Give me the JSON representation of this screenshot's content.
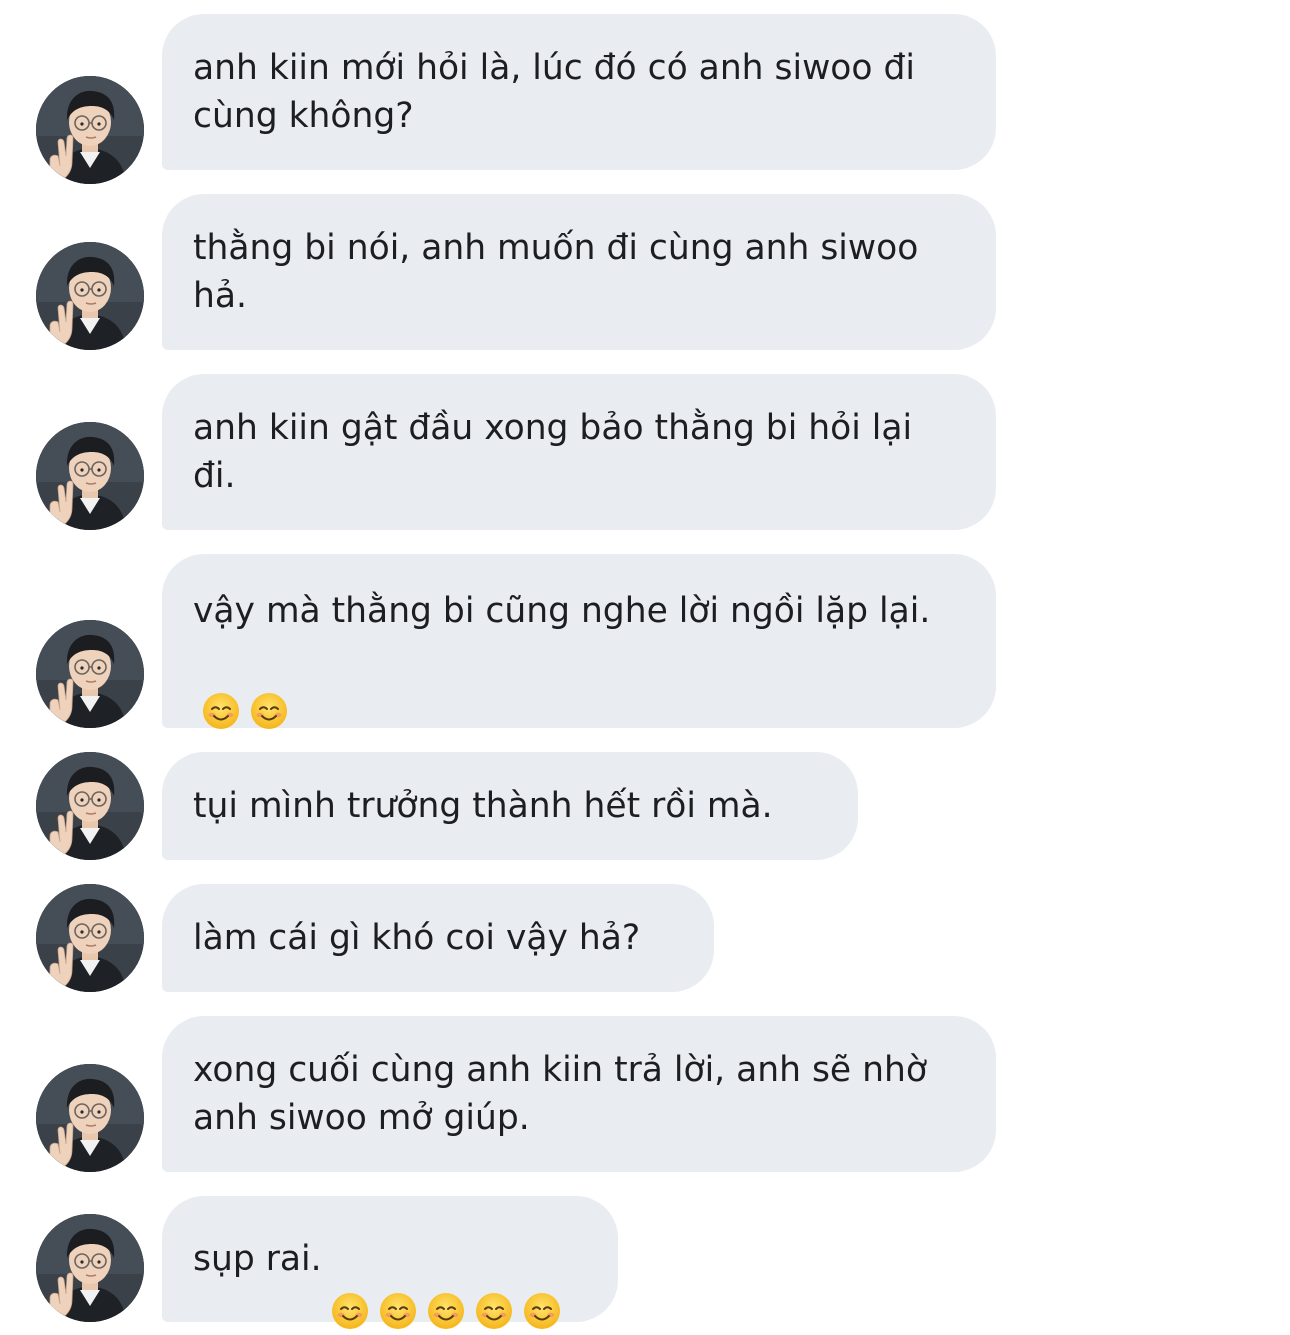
{
  "thread": {
    "messages": [
      {
        "text": "anh kiin mới hỏi là, lúc đó có anh siwoo đi cùng không?",
        "emoji": "",
        "emoji_count": 0
      },
      {
        "text": "thằng bi nói, anh muốn đi cùng anh siwoo hả.",
        "emoji": "",
        "emoji_count": 0
      },
      {
        "text": "anh kiin gật đầu xong bảo thằng bi hỏi lại đi.",
        "emoji": "",
        "emoji_count": 0
      },
      {
        "text": "vậy mà thằng bi cũng nghe lời ngồi lặp lại.",
        "emoji": "smiling-face-emoji",
        "emoji_count": 2
      },
      {
        "text": "tụi mình trưởng thành hết rồi mà.",
        "emoji": "",
        "emoji_count": 0
      },
      {
        "text": "làm cái gì khó coi vậy hả?",
        "emoji": "",
        "emoji_count": 0
      },
      {
        "text": "xong cuối cùng anh kiin trả lời, anh sẽ nhờ anh siwoo mở giúp.",
        "emoji": "",
        "emoji_count": 0
      },
      {
        "text": "sụp rai.",
        "emoji": "smiling-face-emoji",
        "emoji_count": 5
      }
    ]
  },
  "colors": {
    "bubble_background": "#e9ecf0",
    "text": "#1c1e21",
    "page_background": "#ffffff"
  }
}
